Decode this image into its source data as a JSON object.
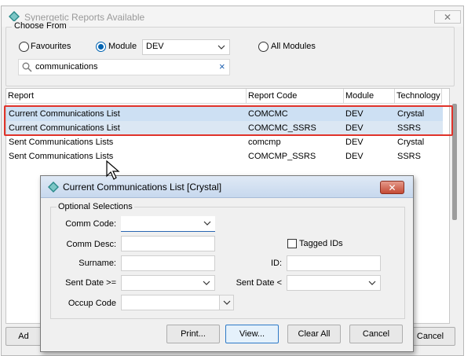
{
  "window": {
    "title": "Synergetic Reports Available",
    "close_label": "✕"
  },
  "choose": {
    "group_label": "Choose From",
    "favourites_label": "Favourites",
    "module_label": "Module",
    "module_value": "DEV",
    "all_modules_label": "All Modules",
    "selected": "Module"
  },
  "search": {
    "value": "communications",
    "clear_label": "×"
  },
  "list": {
    "columns": [
      "Report",
      "Report Code",
      "Module",
      "Technology"
    ],
    "rows": [
      {
        "report": "Current Communications List",
        "code": "COMCMC",
        "module": "DEV",
        "technology": "Crystal"
      },
      {
        "report": "Current Communications List",
        "code": "COMCMC_SSRS",
        "module": "DEV",
        "technology": "SSRS"
      },
      {
        "report": "Sent Communications Lists",
        "code": "comcmp",
        "module": "DEV",
        "technology": "Crystal"
      },
      {
        "report": "Sent Communications Lists",
        "code": "COMCMP_SSRS",
        "module": "DEV",
        "technology": "SSRS"
      }
    ]
  },
  "bg_buttons": {
    "add_partial": "Ad",
    "cancel_label": "Cancel"
  },
  "dialog": {
    "title": "Current Communications List  [Crystal]",
    "close_label": "✕",
    "group_label": "Optional Selections",
    "comm_code_label": "Comm Code:",
    "comm_desc_label": "Comm Desc:",
    "surname_label": "Surname:",
    "sent_date_from_label": "Sent Date >=",
    "occup_code_label": "Occup Code",
    "tagged_ids_label": "Tagged IDs",
    "id_label": "ID:",
    "sent_date_to_label": "Sent Date <",
    "buttons": {
      "print": "Print...",
      "view": "View...",
      "clear_all": "Clear All",
      "cancel": "Cancel"
    }
  },
  "colors": {
    "selection": "#cde0f3",
    "highlight_border": "#e0332a",
    "accent": "#0063b1"
  }
}
